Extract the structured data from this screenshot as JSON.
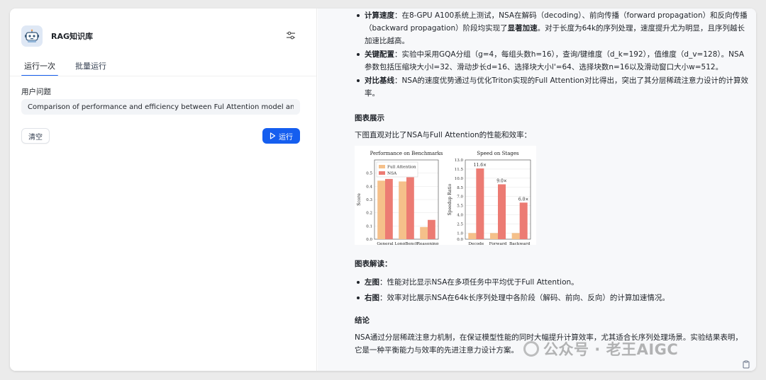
{
  "app": {
    "title": "RAG知识库",
    "logo_icon": "robot-icon"
  },
  "tabs": [
    {
      "label": "运行一次",
      "active": true
    },
    {
      "label": "批量运行",
      "active": false
    }
  ],
  "form": {
    "question_label": "用户问题",
    "question_value": "Comparison of performance and efficiency between Ful Attention model and our NSA",
    "clear_label": "清空",
    "run_label": "运行"
  },
  "result": {
    "bullets_top": [
      {
        "term": "计算速度",
        "pre": "：在8-GPU A100系统上测试，NSA在解码（decoding）、前向传播（forward propagation）和反向传播（backward propagation）阶段均实现了",
        "strong": "显著加速",
        "post": "。对于长度为64k的序列处理，速度提升尤为明显，且序列越长加速比越高。"
      },
      {
        "term": "关键配置",
        "pre": "：实验中采用GQA分组（g=4，每组头数h=16），查询/键维度（d_k=192），值维度（d_v=128）。NSA参数包括压缩块大小l=32、滑动步长d=16、选择块大小l'=64、选择块数n=16以及滑动窗口大小w=512。",
        "strong": "",
        "post": ""
      },
      {
        "term": "对比基线",
        "pre": "：NSA的速度优势通过与优化Triton实现的Full Attention对比得出，突出了其分层稀疏注意力设计的计算效率。",
        "strong": "",
        "post": ""
      }
    ],
    "chart_heading": "图表展示",
    "chart_intro": "下图直观对比了NSA与Full Attention的性能和效率：",
    "interp_heading": "图表解读",
    "interp_bullets": [
      {
        "term": "左图",
        "text": "：性能对比显示NSA在多项任务中平均优于Full Attention。"
      },
      {
        "term": "右图",
        "text": "：效率对比展示NSA在64k长序列处理中各阶段（解码、前向、反向）的计算加速情况。"
      }
    ],
    "conclusion_heading": "结论",
    "conclusion_text": "NSA通过分层稀疏注意力机制，在保证模型性能的同时大幅提升计算效率，尤其适合长序列处理场景。实验结果表明，它是一种平衡能力与效率的先进注意力设计方案。"
  },
  "watermark": "公众号 · 老王AIGC",
  "colors": {
    "accent": "#155eef",
    "full_attention": "#f5c08a",
    "nsa": "#ec7b73"
  },
  "chart_data": [
    {
      "type": "bar",
      "title": "Performance on Benchmarks",
      "ylabel": "Score",
      "xlabel": "",
      "categories": [
        "General",
        "LongBench",
        "Reasoning"
      ],
      "series": [
        {
          "name": "Full Attention",
          "values": [
            0.443,
            0.437,
            0.092
          ]
        },
        {
          "name": "NSA",
          "values": [
            0.456,
            0.469,
            0.146
          ]
        }
      ],
      "ylim": [
        0,
        0.6
      ],
      "yticks": [
        "0.0",
        "0.1",
        "0.2",
        "0.3",
        "0.4",
        "0.5"
      ],
      "grid": true,
      "legend": "top-left"
    },
    {
      "type": "bar",
      "title": "Speed on Stages",
      "ylabel": "Speedup Ratio",
      "xlabel": "",
      "categories": [
        "Decode",
        "Forward",
        "Backward"
      ],
      "series": [
        {
          "name": "Full Attention",
          "values": [
            1.0,
            1.0,
            1.0
          ]
        },
        {
          "name": "NSA",
          "values": [
            11.6,
            9.0,
            6.0
          ]
        }
      ],
      "data_labels": [
        "11.6×",
        "9.0×",
        "6.0×"
      ],
      "ylim": [
        0,
        13
      ],
      "yticks": [
        "0.0",
        "1.0",
        "2.5",
        "4.0",
        "5.5",
        "7.0",
        "8.5",
        "10.0",
        "11.5",
        "13.0"
      ],
      "grid": true
    }
  ]
}
